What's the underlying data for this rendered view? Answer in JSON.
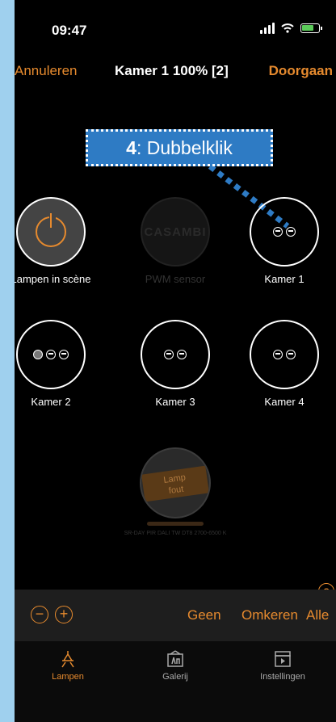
{
  "status_bar": {
    "time": "09:47"
  },
  "nav": {
    "cancel_label": "Annuleren",
    "title": "Kamer 1 100% [2]",
    "continue_label": "Doorgaan"
  },
  "callout": {
    "step": "4",
    "text": ": Dubbelklik"
  },
  "tiles": {
    "scene": {
      "label": "Lampen in scène"
    },
    "pwm": {
      "label": "PWM sensor",
      "logo": "CASAMBI"
    },
    "kamer1": {
      "label": "Kamer 1"
    },
    "kamer2": {
      "label": "Kamer 2"
    },
    "kamer3": {
      "label": "Kamer 3"
    },
    "kamer4": {
      "label": "Kamer 4"
    }
  },
  "broken_lamp": {
    "line1": "Lamp",
    "line2": "fout",
    "name": "SR-DAY PIR DALI TW DT8 2700-6500 K"
  },
  "help": {
    "icon": "question-icon",
    "glyph": "?"
  },
  "toolbar": {
    "minus": "−",
    "plus": "+",
    "none": "Geen",
    "invert": "Omkeren",
    "all": "Alle"
  },
  "tabs": [
    {
      "label": "Lampen",
      "icon": "lamp-icon",
      "active": true
    },
    {
      "label": "Galerij",
      "icon": "gallery-icon",
      "active": false
    },
    {
      "label": "Instellingen",
      "icon": "settings-icon",
      "active": false
    }
  ],
  "colors": {
    "accent": "#e68a2e",
    "background": "#000000",
    "callout": "#2e7bc4",
    "frame": "#9fd0ee"
  }
}
